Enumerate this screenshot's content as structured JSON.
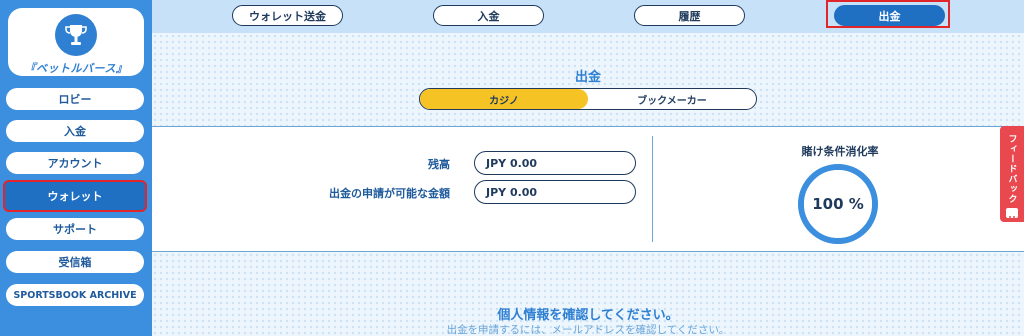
{
  "brand": {
    "name": "『ベットルバース』",
    "logo_icon": "trophy-icon"
  },
  "sidebar": {
    "items": [
      {
        "label": "ロビー"
      },
      {
        "label": "入金"
      },
      {
        "label": "アカウント"
      },
      {
        "label": "ウォレット",
        "active": true
      },
      {
        "label": "サポート"
      },
      {
        "label": "受信箱"
      },
      {
        "label": "SPORTSBOOK ARCHIVE"
      }
    ]
  },
  "topnav": {
    "tabs": [
      {
        "label": "ウォレット送金"
      },
      {
        "label": "入金"
      },
      {
        "label": "履歴"
      },
      {
        "label": "出金",
        "active": true
      }
    ]
  },
  "withdraw": {
    "title": "出金",
    "segments": [
      {
        "label": "カジノ",
        "active": true
      },
      {
        "label": "ブックメーカー"
      }
    ],
    "balance_label": "残高",
    "balance_value": "JPY 0.00",
    "available_label": "出金の申請が可能な金額",
    "available_value": "JPY 0.00",
    "wager_title": "賭け条件消化率",
    "wager_percent": 100,
    "wager_text": "100 %"
  },
  "feedback": {
    "label": "フィードバック",
    "icon": "smile-icon"
  },
  "verify": {
    "title": "個人情報を確認してください。",
    "subtitle": "出金を申請するには、メールアドレスを確認してください。"
  },
  "colors": {
    "sidebar_bg": "#3b8fde",
    "active_blue": "#1f6fc2",
    "highlight_red": "#e0252b",
    "segment_yellow": "#f6c324",
    "feedback_red": "#e8484e"
  }
}
